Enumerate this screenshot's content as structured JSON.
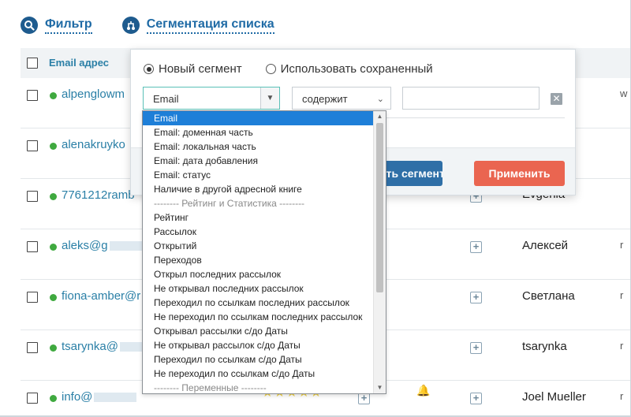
{
  "nav": {
    "filter_label": "Фильтр",
    "segment_label": "Сегментация списка"
  },
  "table": {
    "email_header": "Email адрес",
    "rows": [
      {
        "email": "alpenglowm",
        "name": "",
        "edge": "w"
      },
      {
        "email": "alenakruyko",
        "name": "",
        "edge": ""
      },
      {
        "email": "7761212ramb",
        "name": "Evgenia",
        "edge": ""
      },
      {
        "email": "aleks@g",
        "name": "Алексей",
        "edge": "r"
      },
      {
        "email": "fiona-amber@r",
        "name": "Светлана",
        "edge": "r"
      },
      {
        "email": "tsarynka@",
        "name": "tsarynka",
        "edge": "r"
      },
      {
        "email": "info@",
        "name": "Joel Mueller",
        "edge": "r"
      }
    ],
    "stars": "★★★★★"
  },
  "panel": {
    "radio_new": "Новый сегмент",
    "radio_saved": "Использовать сохраненный",
    "field_select": "Email",
    "operator_select": "содержит",
    "value_input": "",
    "save_segment_label": "ить сегмент",
    "apply_label": "Применить"
  },
  "dropdown": {
    "options": [
      "Email",
      "Email: доменная часть",
      "Email: локальная часть",
      "Email: дата добавления",
      "Email: статус",
      "Наличие в другой адресной книге",
      "-------- Рейтинг и Статистика --------",
      "Рейтинг",
      "Рассылок",
      "Открытий",
      "Переходов",
      "Открыл последних рассылок",
      "Не открывал последних рассылок",
      "Переходил по ссылкам последних рассылок",
      "Не переходил по ссылкам последних рассылок",
      "Открывал рассылки с/до Даты",
      "Не открывал рассылок с/до Даты",
      "Переходил по ссылкам с/до Даты",
      "Не переходил по ссылкам с/до Даты",
      "-------- Переменные --------"
    ],
    "selected_index": 0
  },
  "colors": {
    "link": "#2a7fa6",
    "nav_icon": "#1e5b8e",
    "save_button": "#2f6fa7",
    "apply_button": "#ea6550",
    "selected_option": "#1e7fd8",
    "status_dot": "#3fa93f"
  }
}
